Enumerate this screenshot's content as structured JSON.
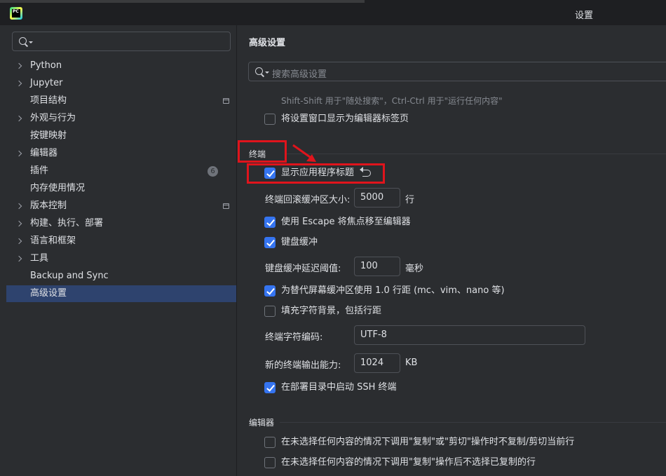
{
  "window": {
    "title": "设置"
  },
  "sidebar": {
    "items": [
      {
        "label": "Python",
        "expandable": true
      },
      {
        "label": "Jupyter",
        "expandable": true
      },
      {
        "label": "项目结构",
        "expandable": false
      },
      {
        "label": "外观与行为",
        "expandable": true
      },
      {
        "label": "按键映射",
        "expandable": false
      },
      {
        "label": "编辑器",
        "expandable": true
      },
      {
        "label": "插件",
        "expandable": false,
        "badge": "6"
      },
      {
        "label": "内存使用情况",
        "expandable": false
      },
      {
        "label": "版本控制",
        "expandable": true
      },
      {
        "label": "构建、执行、部署",
        "expandable": true
      },
      {
        "label": "语言和框架",
        "expandable": true
      },
      {
        "label": "工具",
        "expandable": true
      },
      {
        "label": "Backup and Sync",
        "expandable": false
      },
      {
        "label": "高级设置",
        "expandable": false,
        "selected": true
      }
    ]
  },
  "main": {
    "title": "高级设置",
    "search_placeholder": "搜索高级设置",
    "hint": "Shift-Shift 用于\"随处搜索\"，Ctrl-Ctrl 用于\"运行任何内容\"",
    "open_settings_as_tab": {
      "label": "将设置窗口显示为编辑器标签页",
      "checked": false
    },
    "terminal": {
      "title": "终端",
      "show_app_title": {
        "label": "显示应用程序标题",
        "checked": true
      },
      "scrollback_label": "终端回滚缓冲区大小:",
      "scrollback_value": "5000",
      "scrollback_unit": "行",
      "escape_focus": {
        "label": "使用 Escape 将焦点移至编辑器",
        "checked": true
      },
      "key_buffer": {
        "label": "键盘缓冲",
        "checked": true
      },
      "key_buffer_delay_label": "键盘缓冲延迟阈值:",
      "key_buffer_delay_value": "100",
      "key_buffer_delay_unit": "毫秒",
      "alt_screen_line_spacing": {
        "label": "为替代屏幕缓冲区使用 1.0 行距 (mc、vim、nano 等)",
        "checked": true
      },
      "fill_char_bg": {
        "label": "填充字符背景，包括行距",
        "checked": false
      },
      "encoding_label": "终端字符编码:",
      "encoding_value": "UTF-8",
      "output_capacity_label": "新的终端输出能力:",
      "output_capacity_value": "1024",
      "output_capacity_unit": "KB",
      "ssh_in_deploy": {
        "label": "在部署目录中启动 SSH 终端",
        "checked": true
      }
    },
    "editor": {
      "title": "编辑器",
      "no_copy_cut_line": {
        "label": "在未选择任何内容的情况下调用\"复制\"或\"剪切\"操作时不复制/剪切当前行",
        "checked": false
      },
      "no_select_after_copy": {
        "label": "在未选择任何内容的情况下调用\"复制\"操作后不选择已复制的行",
        "checked": false
      }
    }
  },
  "colors": {
    "accent": "#3574f0",
    "selection": "#2e436e",
    "annotation": "#e0141c",
    "background": "#2b2d30"
  }
}
